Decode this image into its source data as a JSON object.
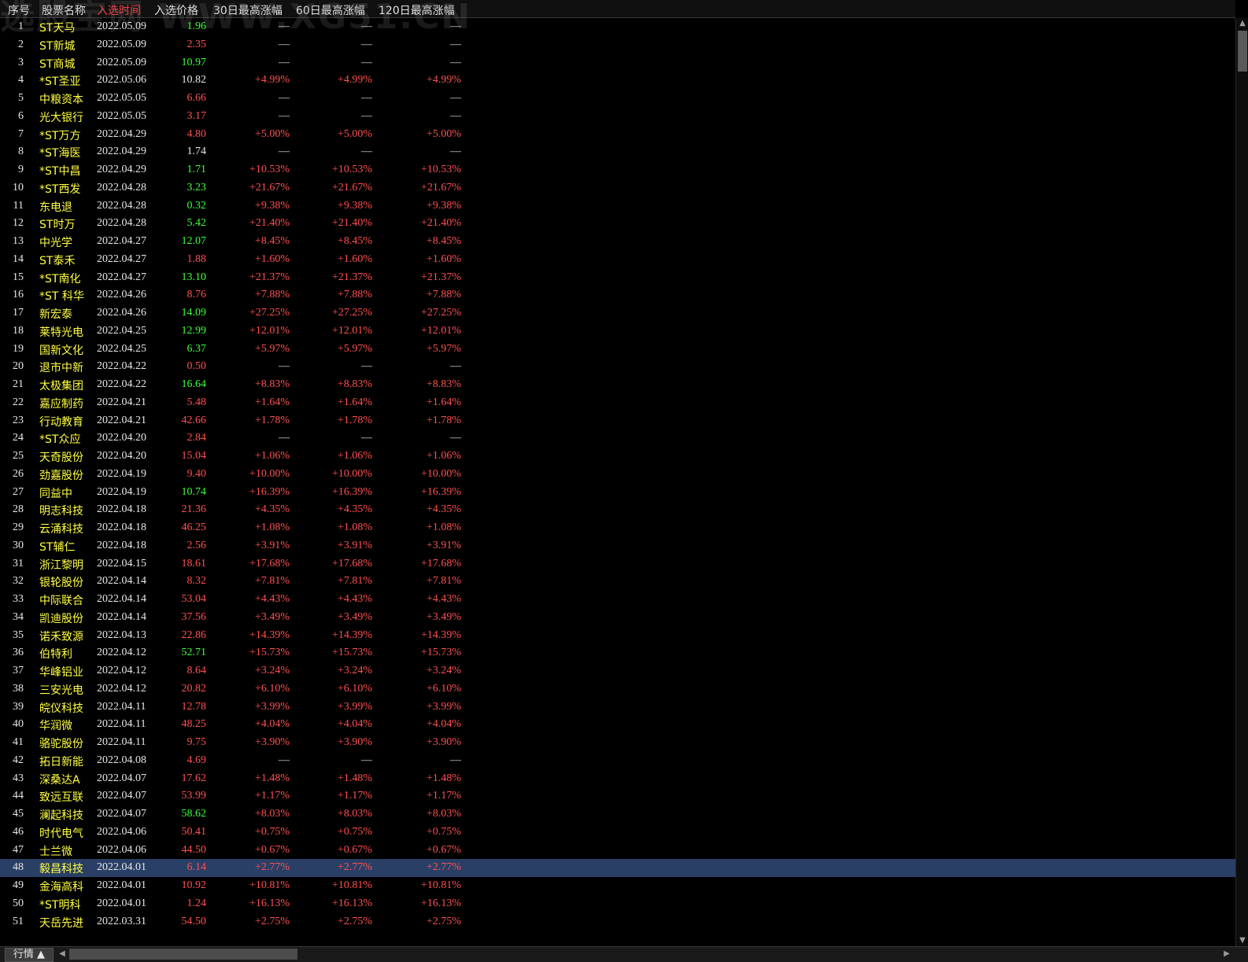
{
  "header": {
    "col_idx": "序号",
    "col_name": "股票名称",
    "col_date": "入选时间",
    "col_price": "入选价格",
    "col_30": "30日最高涨幅",
    "col_60": "60日最高涨幅",
    "col_120": "120日最高涨幅"
  },
  "watermark": "选股宝网 WWW.XG51.CN",
  "colors": {
    "up": "#ff5050",
    "down": "#3cff3c",
    "flat": "#e8e8e8",
    "name": "#ffff40",
    "selected_row": "#2a3f66"
  },
  "selected_index": 48,
  "rows": [
    {
      "idx": "1",
      "name": "ST天马",
      "date": "2022.05.09",
      "price": "1.96",
      "pc": "green",
      "g30": "—",
      "g60": "—",
      "g120": "—"
    },
    {
      "idx": "2",
      "name": "ST新城",
      "date": "2022.05.09",
      "price": "2.35",
      "pc": "red",
      "g30": "—",
      "g60": "—",
      "g120": "—"
    },
    {
      "idx": "3",
      "name": "ST商城",
      "date": "2022.05.09",
      "price": "10.97",
      "pc": "green",
      "g30": "—",
      "g60": "—",
      "g120": "—"
    },
    {
      "idx": "4",
      "name": "*ST圣亚",
      "date": "2022.05.06",
      "price": "10.82",
      "pc": "white",
      "g30": "+4.99%",
      "g60": "+4.99%",
      "g120": "+4.99%"
    },
    {
      "idx": "5",
      "name": "中粮资本",
      "date": "2022.05.05",
      "price": "6.66",
      "pc": "red",
      "g30": "—",
      "g60": "—",
      "g120": "—"
    },
    {
      "idx": "6",
      "name": "光大银行",
      "date": "2022.05.05",
      "price": "3.17",
      "pc": "red",
      "g30": "—",
      "g60": "—",
      "g120": "—"
    },
    {
      "idx": "7",
      "name": "*ST万方",
      "date": "2022.04.29",
      "price": "4.80",
      "pc": "red",
      "g30": "+5.00%",
      "g60": "+5.00%",
      "g120": "+5.00%"
    },
    {
      "idx": "8",
      "name": "*ST海医",
      "date": "2022.04.29",
      "price": "1.74",
      "pc": "white",
      "g30": "—",
      "g60": "—",
      "g120": "—"
    },
    {
      "idx": "9",
      "name": "*ST中昌",
      "date": "2022.04.29",
      "price": "1.71",
      "pc": "green",
      "g30": "+10.53%",
      "g60": "+10.53%",
      "g120": "+10.53%"
    },
    {
      "idx": "10",
      "name": "*ST西发",
      "date": "2022.04.28",
      "price": "3.23",
      "pc": "green",
      "g30": "+21.67%",
      "g60": "+21.67%",
      "g120": "+21.67%"
    },
    {
      "idx": "11",
      "name": "东电退",
      "date": "2022.04.28",
      "price": "0.32",
      "pc": "green",
      "g30": "+9.38%",
      "g60": "+9.38%",
      "g120": "+9.38%"
    },
    {
      "idx": "12",
      "name": "ST时万",
      "date": "2022.04.28",
      "price": "5.42",
      "pc": "green",
      "g30": "+21.40%",
      "g60": "+21.40%",
      "g120": "+21.40%"
    },
    {
      "idx": "13",
      "name": "中光学",
      "date": "2022.04.27",
      "price": "12.07",
      "pc": "green",
      "g30": "+8.45%",
      "g60": "+8.45%",
      "g120": "+8.45%"
    },
    {
      "idx": "14",
      "name": "ST泰禾",
      "date": "2022.04.27",
      "price": "1.88",
      "pc": "red",
      "g30": "+1.60%",
      "g60": "+1.60%",
      "g120": "+1.60%"
    },
    {
      "idx": "15",
      "name": "*ST南化",
      "date": "2022.04.27",
      "price": "13.10",
      "pc": "green",
      "g30": "+21.37%",
      "g60": "+21.37%",
      "g120": "+21.37%"
    },
    {
      "idx": "16",
      "name": "*ST 科华",
      "date": "2022.04.26",
      "price": "8.76",
      "pc": "red",
      "g30": "+7.88%",
      "g60": "+7.88%",
      "g120": "+7.88%"
    },
    {
      "idx": "17",
      "name": "新宏泰",
      "date": "2022.04.26",
      "price": "14.09",
      "pc": "green",
      "g30": "+27.25%",
      "g60": "+27.25%",
      "g120": "+27.25%"
    },
    {
      "idx": "18",
      "name": "莱特光电",
      "date": "2022.04.25",
      "price": "12.99",
      "pc": "green",
      "g30": "+12.01%",
      "g60": "+12.01%",
      "g120": "+12.01%"
    },
    {
      "idx": "19",
      "name": "国新文化",
      "date": "2022.04.25",
      "price": "6.37",
      "pc": "green",
      "g30": "+5.97%",
      "g60": "+5.97%",
      "g120": "+5.97%"
    },
    {
      "idx": "20",
      "name": "退市中新",
      "date": "2022.04.22",
      "price": "0.50",
      "pc": "red",
      "g30": "—",
      "g60": "—",
      "g120": "—"
    },
    {
      "idx": "21",
      "name": "太极集团",
      "date": "2022.04.22",
      "price": "16.64",
      "pc": "green",
      "g30": "+8.83%",
      "g60": "+8.83%",
      "g120": "+8.83%"
    },
    {
      "idx": "22",
      "name": "嘉应制药",
      "date": "2022.04.21",
      "price": "5.48",
      "pc": "red",
      "g30": "+1.64%",
      "g60": "+1.64%",
      "g120": "+1.64%"
    },
    {
      "idx": "23",
      "name": "行动教育",
      "date": "2022.04.21",
      "price": "42.66",
      "pc": "red",
      "g30": "+1.78%",
      "g60": "+1.78%",
      "g120": "+1.78%"
    },
    {
      "idx": "24",
      "name": "*ST众应",
      "date": "2022.04.20",
      "price": "2.84",
      "pc": "red",
      "g30": "—",
      "g60": "—",
      "g120": "—"
    },
    {
      "idx": "25",
      "name": "天奇股份",
      "date": "2022.04.20",
      "price": "15.04",
      "pc": "red",
      "g30": "+1.06%",
      "g60": "+1.06%",
      "g120": "+1.06%"
    },
    {
      "idx": "26",
      "name": "劲嘉股份",
      "date": "2022.04.19",
      "price": "9.40",
      "pc": "red",
      "g30": "+10.00%",
      "g60": "+10.00%",
      "g120": "+10.00%"
    },
    {
      "idx": "27",
      "name": "同益中",
      "date": "2022.04.19",
      "price": "10.74",
      "pc": "green",
      "g30": "+16.39%",
      "g60": "+16.39%",
      "g120": "+16.39%"
    },
    {
      "idx": "28",
      "name": "明志科技",
      "date": "2022.04.18",
      "price": "21.36",
      "pc": "red",
      "g30": "+4.35%",
      "g60": "+4.35%",
      "g120": "+4.35%"
    },
    {
      "idx": "29",
      "name": "云涌科技",
      "date": "2022.04.18",
      "price": "46.25",
      "pc": "red",
      "g30": "+1.08%",
      "g60": "+1.08%",
      "g120": "+1.08%"
    },
    {
      "idx": "30",
      "name": "ST辅仁",
      "date": "2022.04.18",
      "price": "2.56",
      "pc": "red",
      "g30": "+3.91%",
      "g60": "+3.91%",
      "g120": "+3.91%"
    },
    {
      "idx": "31",
      "name": "浙江黎明",
      "date": "2022.04.15",
      "price": "18.61",
      "pc": "red",
      "g30": "+17.68%",
      "g60": "+17.68%",
      "g120": "+17.68%"
    },
    {
      "idx": "32",
      "name": "银轮股份",
      "date": "2022.04.14",
      "price": "8.32",
      "pc": "red",
      "g30": "+7.81%",
      "g60": "+7.81%",
      "g120": "+7.81%"
    },
    {
      "idx": "33",
      "name": "中际联合",
      "date": "2022.04.14",
      "price": "53.04",
      "pc": "red",
      "g30": "+4.43%",
      "g60": "+4.43%",
      "g120": "+4.43%"
    },
    {
      "idx": "34",
      "name": "凯迪股份",
      "date": "2022.04.14",
      "price": "37.56",
      "pc": "red",
      "g30": "+3.49%",
      "g60": "+3.49%",
      "g120": "+3.49%"
    },
    {
      "idx": "35",
      "name": "诺禾致源",
      "date": "2022.04.13",
      "price": "22.86",
      "pc": "red",
      "g30": "+14.39%",
      "g60": "+14.39%",
      "g120": "+14.39%"
    },
    {
      "idx": "36",
      "name": "伯特利",
      "date": "2022.04.12",
      "price": "52.71",
      "pc": "green",
      "g30": "+15.73%",
      "g60": "+15.73%",
      "g120": "+15.73%"
    },
    {
      "idx": "37",
      "name": "华峰铝业",
      "date": "2022.04.12",
      "price": "8.64",
      "pc": "red",
      "g30": "+3.24%",
      "g60": "+3.24%",
      "g120": "+3.24%"
    },
    {
      "idx": "38",
      "name": "三安光电",
      "date": "2022.04.12",
      "price": "20.82",
      "pc": "red",
      "g30": "+6.10%",
      "g60": "+6.10%",
      "g120": "+6.10%"
    },
    {
      "idx": "39",
      "name": "皖仪科技",
      "date": "2022.04.11",
      "price": "12.78",
      "pc": "red",
      "g30": "+3.99%",
      "g60": "+3.99%",
      "g120": "+3.99%"
    },
    {
      "idx": "40",
      "name": "华润微",
      "date": "2022.04.11",
      "price": "48.25",
      "pc": "red",
      "g30": "+4.04%",
      "g60": "+4.04%",
      "g120": "+4.04%"
    },
    {
      "idx": "41",
      "name": "骆驼股份",
      "date": "2022.04.11",
      "price": "9.75",
      "pc": "red",
      "g30": "+3.90%",
      "g60": "+3.90%",
      "g120": "+3.90%"
    },
    {
      "idx": "42",
      "name": "拓日新能",
      "date": "2022.04.08",
      "price": "4.69",
      "pc": "red",
      "g30": "—",
      "g60": "—",
      "g120": "—"
    },
    {
      "idx": "43",
      "name": "深桑达A",
      "date": "2022.04.07",
      "price": "17.62",
      "pc": "red",
      "g30": "+1.48%",
      "g60": "+1.48%",
      "g120": "+1.48%"
    },
    {
      "idx": "44",
      "name": "致远互联",
      "date": "2022.04.07",
      "price": "53.99",
      "pc": "red",
      "g30": "+1.17%",
      "g60": "+1.17%",
      "g120": "+1.17%"
    },
    {
      "idx": "45",
      "name": "澜起科技",
      "date": "2022.04.07",
      "price": "58.62",
      "pc": "green",
      "g30": "+8.03%",
      "g60": "+8.03%",
      "g120": "+8.03%"
    },
    {
      "idx": "46",
      "name": "时代电气",
      "date": "2022.04.06",
      "price": "50.41",
      "pc": "red",
      "g30": "+0.75%",
      "g60": "+0.75%",
      "g120": "+0.75%"
    },
    {
      "idx": "47",
      "name": "士兰微",
      "date": "2022.04.06",
      "price": "44.50",
      "pc": "red",
      "g30": "+0.67%",
      "g60": "+0.67%",
      "g120": "+0.67%"
    },
    {
      "idx": "48",
      "name": "毅昌科技",
      "date": "2022.04.01",
      "price": "6.14",
      "pc": "red",
      "g30": "+2.77%",
      "g60": "+2.77%",
      "g120": "+2.77%"
    },
    {
      "idx": "49",
      "name": "金海高科",
      "date": "2022.04.01",
      "price": "10.92",
      "pc": "red",
      "g30": "+10.81%",
      "g60": "+10.81%",
      "g120": "+10.81%"
    },
    {
      "idx": "50",
      "name": "*ST明科",
      "date": "2022.04.01",
      "price": "1.24",
      "pc": "red",
      "g30": "+16.13%",
      "g60": "+16.13%",
      "g120": "+16.13%"
    },
    {
      "idx": "51",
      "name": "天岳先进",
      "date": "2022.03.31",
      "price": "54.50",
      "pc": "red",
      "g30": "+2.75%",
      "g60": "+2.75%",
      "g120": "+2.75%"
    }
  ],
  "footer": {
    "tab_label": "行情 ▲",
    "scroll_left_icon": "◀",
    "scroll_right_icon": "▶"
  },
  "vscroll": {
    "up_icon": "▲",
    "down_icon": "▼"
  }
}
